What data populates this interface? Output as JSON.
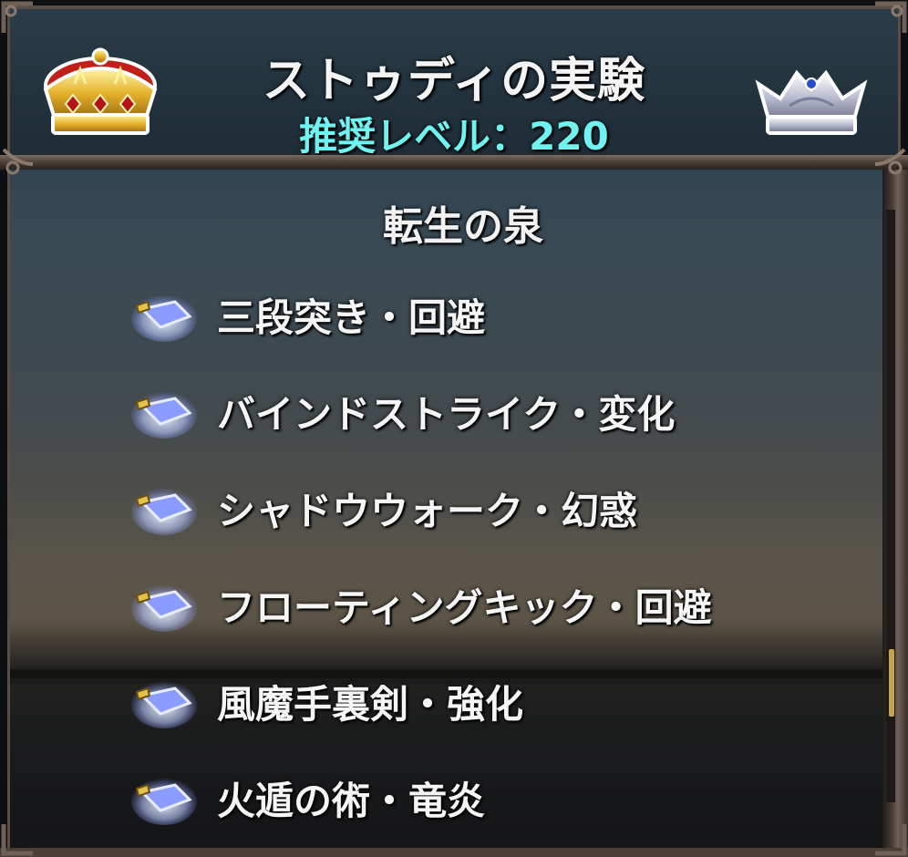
{
  "header": {
    "title": "ストゥディの実験",
    "recommended_level": "推奨レベル：220"
  },
  "section": {
    "title": "転生の泉"
  },
  "skills": [
    {
      "label": "三段突き・回避",
      "icon": "crystal-icon"
    },
    {
      "label": "バインドストライク・変化",
      "icon": "crystal-icon"
    },
    {
      "label": "シャドウウォーク・幻惑",
      "icon": "crystal-icon"
    },
    {
      "label": "フローティングキック・回避",
      "icon": "crystal-icon"
    },
    {
      "label": "風魔手裏剣・強化",
      "icon": "crystal-icon"
    },
    {
      "label": "火遁の術・竜炎",
      "icon": "crystal-icon"
    }
  ],
  "icons": {
    "left_crown": "gold-crown-icon",
    "right_crown": "silver-crown-icon"
  },
  "colors": {
    "title_text": "#f4f4f4",
    "level_text": "#6ff2f0",
    "frame": "#5a4d44",
    "scroll_thumb": "#c9a44a"
  }
}
